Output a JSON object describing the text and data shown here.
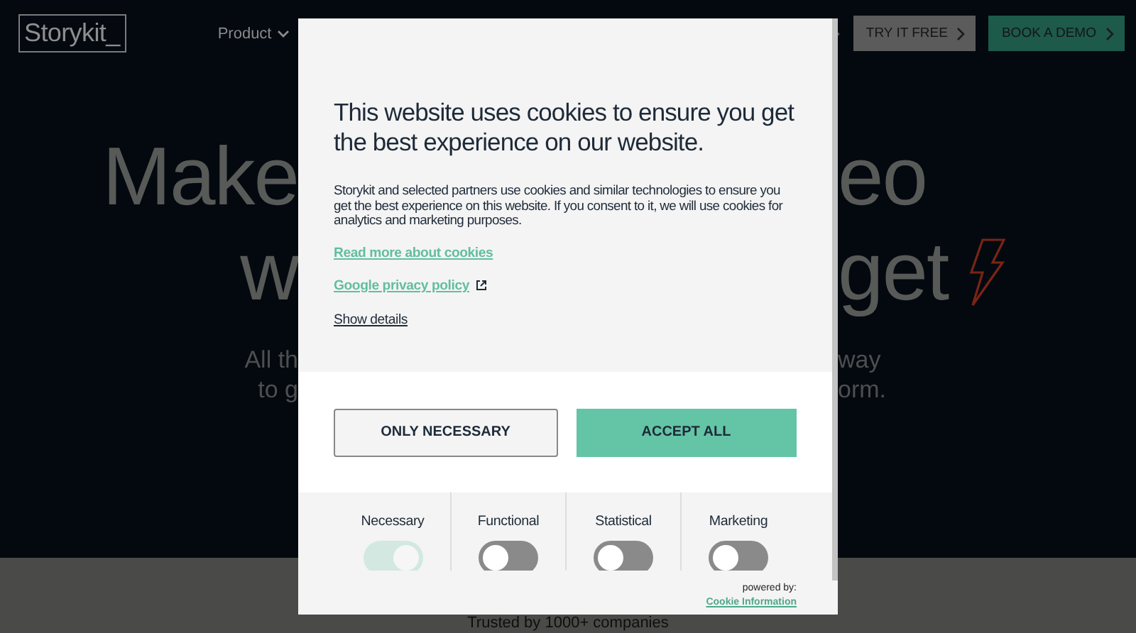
{
  "nav": {
    "logo": "Storykit_",
    "menu": [
      {
        "label": "Product"
      }
    ],
    "actions": [
      {
        "label": "TRY IT FREE",
        "kind": "secondary"
      },
      {
        "label": "BOOK A DEMO",
        "kind": "primary"
      }
    ]
  },
  "hero": {
    "headline": [
      [
        "Make",
        "eo"
      ],
      [
        "w",
        "get"
      ]
    ],
    "subtitle": [
      [
        "All th",
        "way"
      ],
      [
        "to g",
        "orm."
      ]
    ]
  },
  "trusted": "Trusted by 1000+ companies",
  "cookie_dialog": {
    "title": "This website uses cookies to ensure you get the best experience on our website.",
    "body": "Storykit and selected partners use cookies and similar technologies to ensure you get the best experience on this website. If you consent to it, we will use cookies for analytics and marketing purposes.",
    "links": [
      {
        "label": "Read more about cookies",
        "kind": "link",
        "external": false
      },
      {
        "label": "Google privacy policy",
        "kind": "link",
        "external": true
      },
      {
        "label": "Show details",
        "kind": "details",
        "external": false
      }
    ],
    "buttons": [
      {
        "label": "ONLY NECESSARY",
        "kind": "outline"
      },
      {
        "label": "ACCEPT ALL",
        "kind": "filled"
      }
    ],
    "categories": [
      {
        "label": "Necessary",
        "on": true,
        "disabled": true
      },
      {
        "label": "Functional",
        "on": false,
        "disabled": false
      },
      {
        "label": "Statistical",
        "on": false,
        "disabled": false
      },
      {
        "label": "Marketing",
        "on": false,
        "disabled": false
      }
    ],
    "powered_by": "powered by:",
    "provider": "Cookie Information"
  }
}
